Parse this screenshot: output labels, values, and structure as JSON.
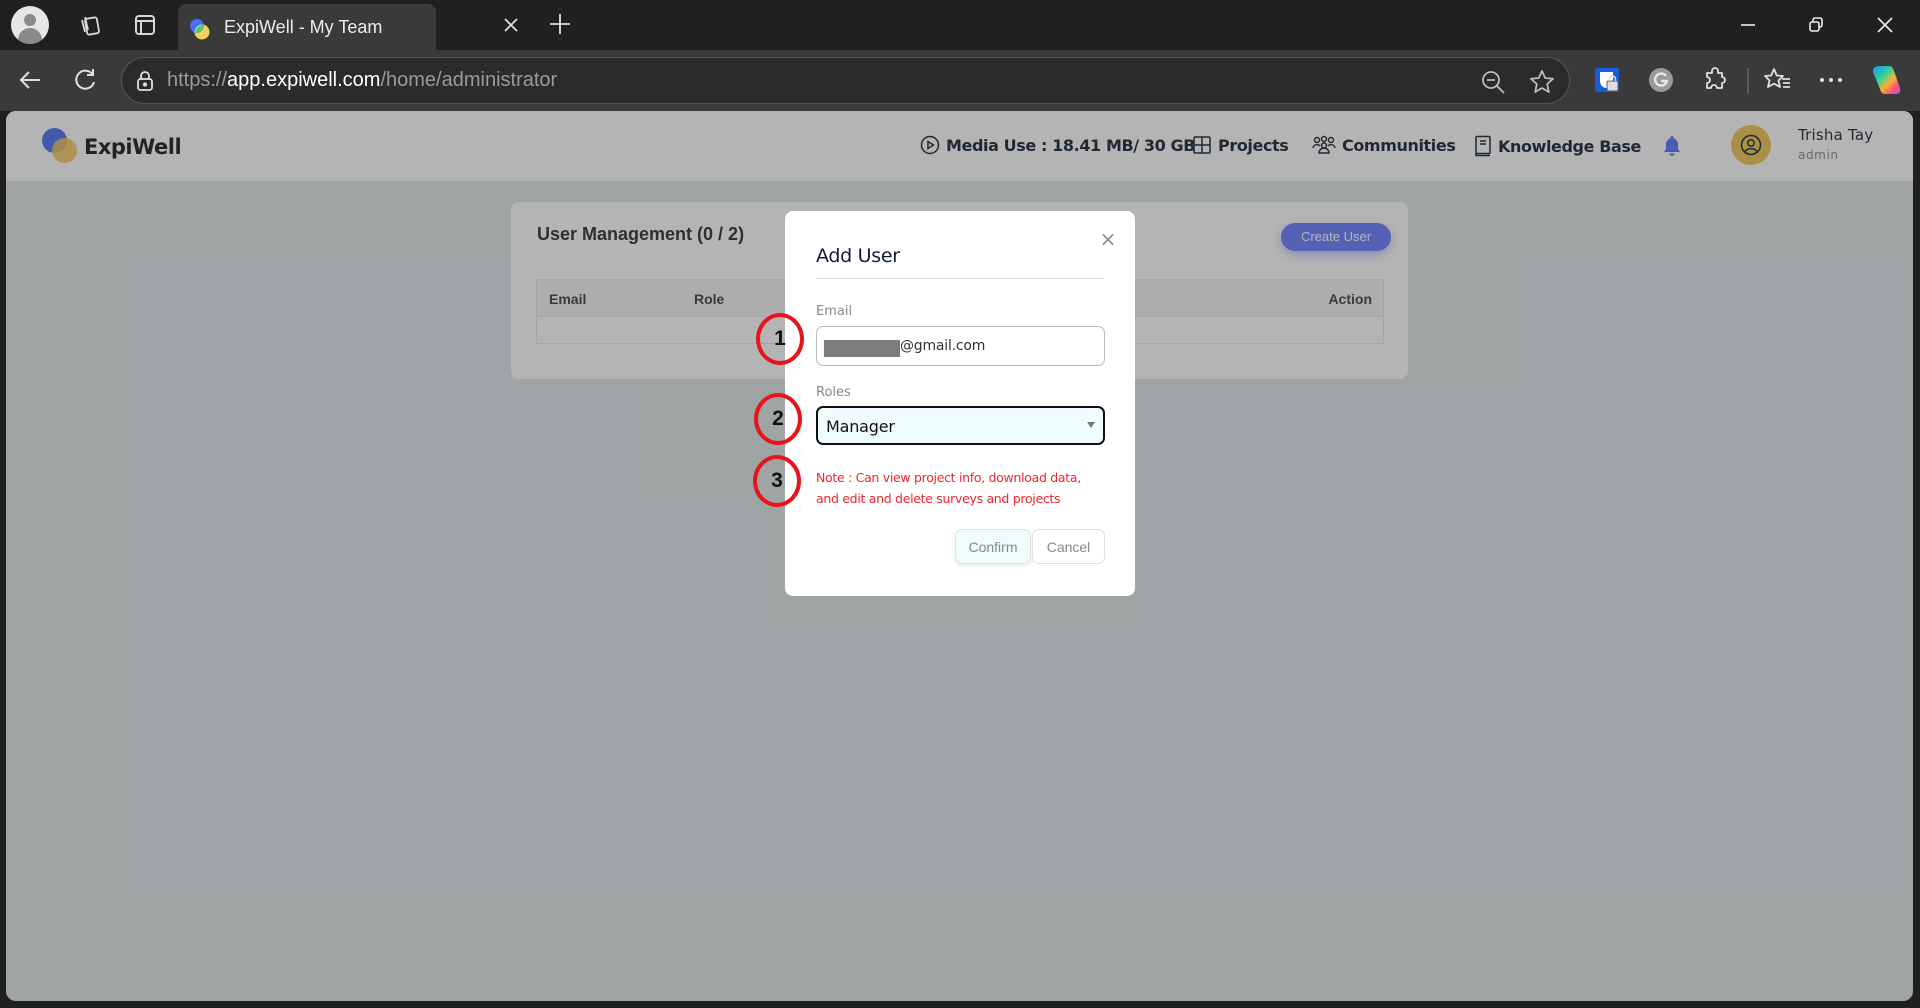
{
  "browser": {
    "tab_title": "ExpiWell - My Team",
    "url_scheme": "https://",
    "url_host": "app.expiwell.com",
    "url_path": "/home/administrator",
    "icons": [
      "profile-icon",
      "workspaces-icon",
      "vertical-tabs-icon",
      "tab-close-icon",
      "new-tab-icon",
      "minimize-icon",
      "restore-icon",
      "close-window-icon",
      "back-icon",
      "refresh-icon",
      "lock-icon",
      "zoom-out-icon",
      "favorite-star-icon",
      "bitwarden-extension-icon",
      "grammarly-extension-icon",
      "extensions-icon",
      "favorites-icon",
      "more-icon",
      "copilot-icon"
    ]
  },
  "header": {
    "brand": "ExpiWell",
    "media_use": "Media Use : 18.41 MB/ 30 GB",
    "nav": {
      "projects": "Projects",
      "communities": "Communities",
      "knowledge_base": "Knowledge Base"
    },
    "user": {
      "name": "Trisha Tay",
      "role": "admin"
    },
    "colors": {
      "accent": "#6d80ff",
      "avatar": "#f1c757"
    }
  },
  "user_management": {
    "title": "User Management (0 / 2)",
    "create_button": "Create User",
    "columns": [
      "Email",
      "Role",
      "Action"
    ],
    "rows": []
  },
  "dialog": {
    "title": "Add User",
    "email_label": "Email",
    "email_value": "@gmail.com",
    "email_redacted": true,
    "roles_label": "Roles",
    "roles_value": "Manager",
    "note": "Note : Can view project info, download data, and edit and delete surveys and projects",
    "confirm": "Confirm",
    "cancel": "Cancel",
    "note_color": "#f0262e"
  },
  "annotations": [
    "1",
    "2",
    "3"
  ]
}
